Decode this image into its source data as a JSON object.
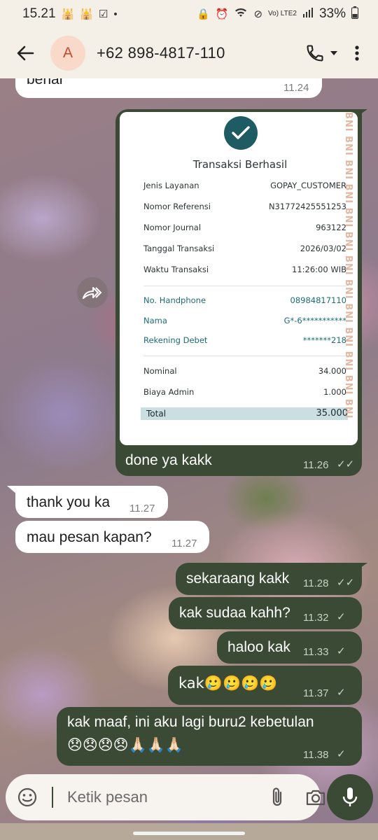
{
  "status_bar": {
    "time": "15.21",
    "battery": "33%",
    "network": "Vo) LTE2"
  },
  "header": {
    "avatar_letter": "A",
    "contact": "+62 898-4817-110"
  },
  "messages": [
    {
      "id": "m0",
      "dir": "in",
      "text": "benar",
      "time": "11.24"
    },
    {
      "id": "m1",
      "dir": "out",
      "text": "done ya kakk",
      "time": "11.26",
      "status": "read"
    },
    {
      "id": "m2",
      "dir": "in",
      "text": "thank you ka",
      "time": "11.27"
    },
    {
      "id": "m3",
      "dir": "in",
      "text": "mau pesan kapan?",
      "time": "11.27"
    },
    {
      "id": "m4",
      "dir": "out",
      "text": "sekaraang kakk",
      "time": "11.28",
      "status": "read"
    },
    {
      "id": "m5",
      "dir": "out",
      "text": "kak sudaa kahh?",
      "time": "11.32",
      "status": "sent"
    },
    {
      "id": "m6",
      "dir": "out",
      "text": "haloo kak",
      "time": "11.33",
      "status": "sent"
    },
    {
      "id": "m7",
      "dir": "out",
      "text": "kak🥲🥲🥲🥲",
      "time": "11.37",
      "status": "sent"
    },
    {
      "id": "m8",
      "dir": "out",
      "text_line1": "kak maaf, ini aku lagi buru2 kebetulan",
      "text_line2": "😞😞😞😞🙏🏻🙏🏻🙏🏻",
      "time": "11.38",
      "status": "sent"
    }
  ],
  "receipt": {
    "title": "Transaksi Berhasil",
    "watermark": "BNI BNI BNI BNI BNI BNI BNI BNI BNI BNI BNI BNI BNI BNI BNI BNI",
    "rows": [
      {
        "key": "Jenis Layanan",
        "value": "GOPAY_CUSTOMER"
      },
      {
        "key": "Nomor Referensi",
        "value": "N31772425551253"
      },
      {
        "key": "Nomor Journal",
        "value": "963122"
      },
      {
        "key": "Tanggal Transaksi",
        "value": "2026/03/02"
      },
      {
        "key": "Waktu Transaksi",
        "value": "11:26:00 WIB"
      }
    ],
    "account_rows": [
      {
        "key": "No. Handphone",
        "value": "08984817110"
      },
      {
        "key": "Nama",
        "value": "G*-6***********"
      },
      {
        "key": "Rekening Debet",
        "value": "*******218"
      }
    ],
    "amount_rows": [
      {
        "key": "Nominal",
        "value": "34.000"
      },
      {
        "key": "Biaya Admin",
        "value": "1.000"
      }
    ],
    "total": {
      "key": "Total",
      "value": "35.000"
    }
  },
  "composer": {
    "placeholder": "Ketik pesan"
  },
  "colors": {
    "outgoing_bubble": "#3a4a35",
    "incoming_bubble": "#ffffff",
    "receipt_accent": "#1e5b63"
  }
}
